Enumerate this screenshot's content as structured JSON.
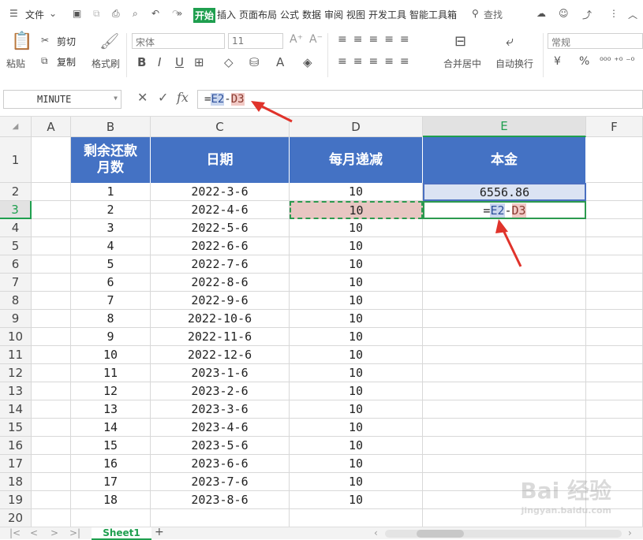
{
  "menubar": {
    "file_label": "文件",
    "tabs": [
      {
        "label": "开始",
        "active": true
      },
      {
        "label": "插入"
      },
      {
        "label": "页面布局"
      },
      {
        "label": "公式"
      },
      {
        "label": "数据"
      },
      {
        "label": "审阅"
      },
      {
        "label": "视图"
      },
      {
        "label": "开发工具"
      },
      {
        "label": "智能工具箱"
      }
    ],
    "search_label": "查找"
  },
  "ribbon": {
    "paste": "粘贴",
    "cut": "剪切",
    "copy": "复制",
    "format_painter": "格式刷",
    "font_name": "宋体",
    "font_size": "11",
    "merge_center": "合并居中",
    "wrap_text": "自动换行",
    "number_format": "常规",
    "currency": "¥",
    "percent": "%"
  },
  "formula_bar": {
    "name_box": "MINUTE",
    "fx": "fx",
    "formula_prefix": "=",
    "ref1": "E2",
    "op": "-",
    "ref2": "D3"
  },
  "columns": [
    "A",
    "B",
    "C",
    "D",
    "E",
    "F"
  ],
  "rows": [
    "1",
    "2",
    "3",
    "4",
    "5",
    "6",
    "7",
    "8",
    "9",
    "10",
    "11",
    "12",
    "13",
    "14",
    "15",
    "16",
    "17",
    "18",
    "19",
    "20"
  ],
  "table": {
    "headers": [
      "剩余还款\n月数",
      "日期",
      "每月递减",
      "本金"
    ],
    "rows": [
      [
        "1",
        "2022-3-6",
        "10",
        "6556.86"
      ],
      [
        "2",
        "2022-4-6",
        "10",
        ""
      ],
      [
        "3",
        "2022-5-6",
        "10",
        ""
      ],
      [
        "4",
        "2022-6-6",
        "10",
        ""
      ],
      [
        "5",
        "2022-7-6",
        "10",
        ""
      ],
      [
        "6",
        "2022-8-6",
        "10",
        ""
      ],
      [
        "7",
        "2022-9-6",
        "10",
        ""
      ],
      [
        "8",
        "2022-10-6",
        "10",
        ""
      ],
      [
        "9",
        "2022-11-6",
        "10",
        ""
      ],
      [
        "10",
        "2022-12-6",
        "10",
        ""
      ],
      [
        "11",
        "2023-1-6",
        "10",
        ""
      ],
      [
        "12",
        "2023-2-6",
        "10",
        ""
      ],
      [
        "13",
        "2023-3-6",
        "10",
        ""
      ],
      [
        "14",
        "2023-4-6",
        "10",
        ""
      ],
      [
        "15",
        "2023-5-6",
        "10",
        ""
      ],
      [
        "16",
        "2023-6-6",
        "10",
        ""
      ],
      [
        "17",
        "2023-7-6",
        "10",
        ""
      ],
      [
        "18",
        "2023-8-6",
        "10",
        ""
      ]
    ],
    "editing_cell": {
      "prefix": "=",
      "ref1": "E2",
      "op": "-",
      "ref2": "D3"
    }
  },
  "sheet_tab": "Sheet1",
  "add_sheet": "+",
  "watermark": {
    "text": "Bai 经验",
    "sub": "jingyan.baidu.com"
  },
  "colors": {
    "accent": "#1f9f4f",
    "header_fill": "#4472c4",
    "ref_e": "#c9d6ee",
    "ref_d": "#f1c9c5",
    "arrow": "#e0332b"
  }
}
